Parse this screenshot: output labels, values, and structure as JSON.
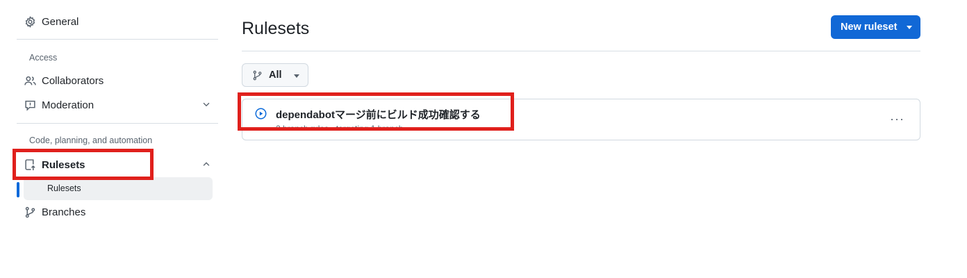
{
  "sidebar": {
    "general_label": "General",
    "access_section": "Access",
    "collaborators_label": "Collaborators",
    "moderation_label": "Moderation",
    "code_section": "Code, planning, and automation",
    "rulesets_label": "Rulesets",
    "rulesets_sub_label": "Rulesets",
    "branches_label": "Branches"
  },
  "main": {
    "title": "Rulesets",
    "new_ruleset_label": "New ruleset",
    "filter_label": "All",
    "ruleset": {
      "name": "dependabotマージ前にビルド成功確認する",
      "meta": "2 branch rules · targeting 1 branch"
    },
    "more_label": "···"
  },
  "colors": {
    "accent": "#1168d6",
    "highlight_box": "#e0201c",
    "selected_bar": "#0969da"
  }
}
